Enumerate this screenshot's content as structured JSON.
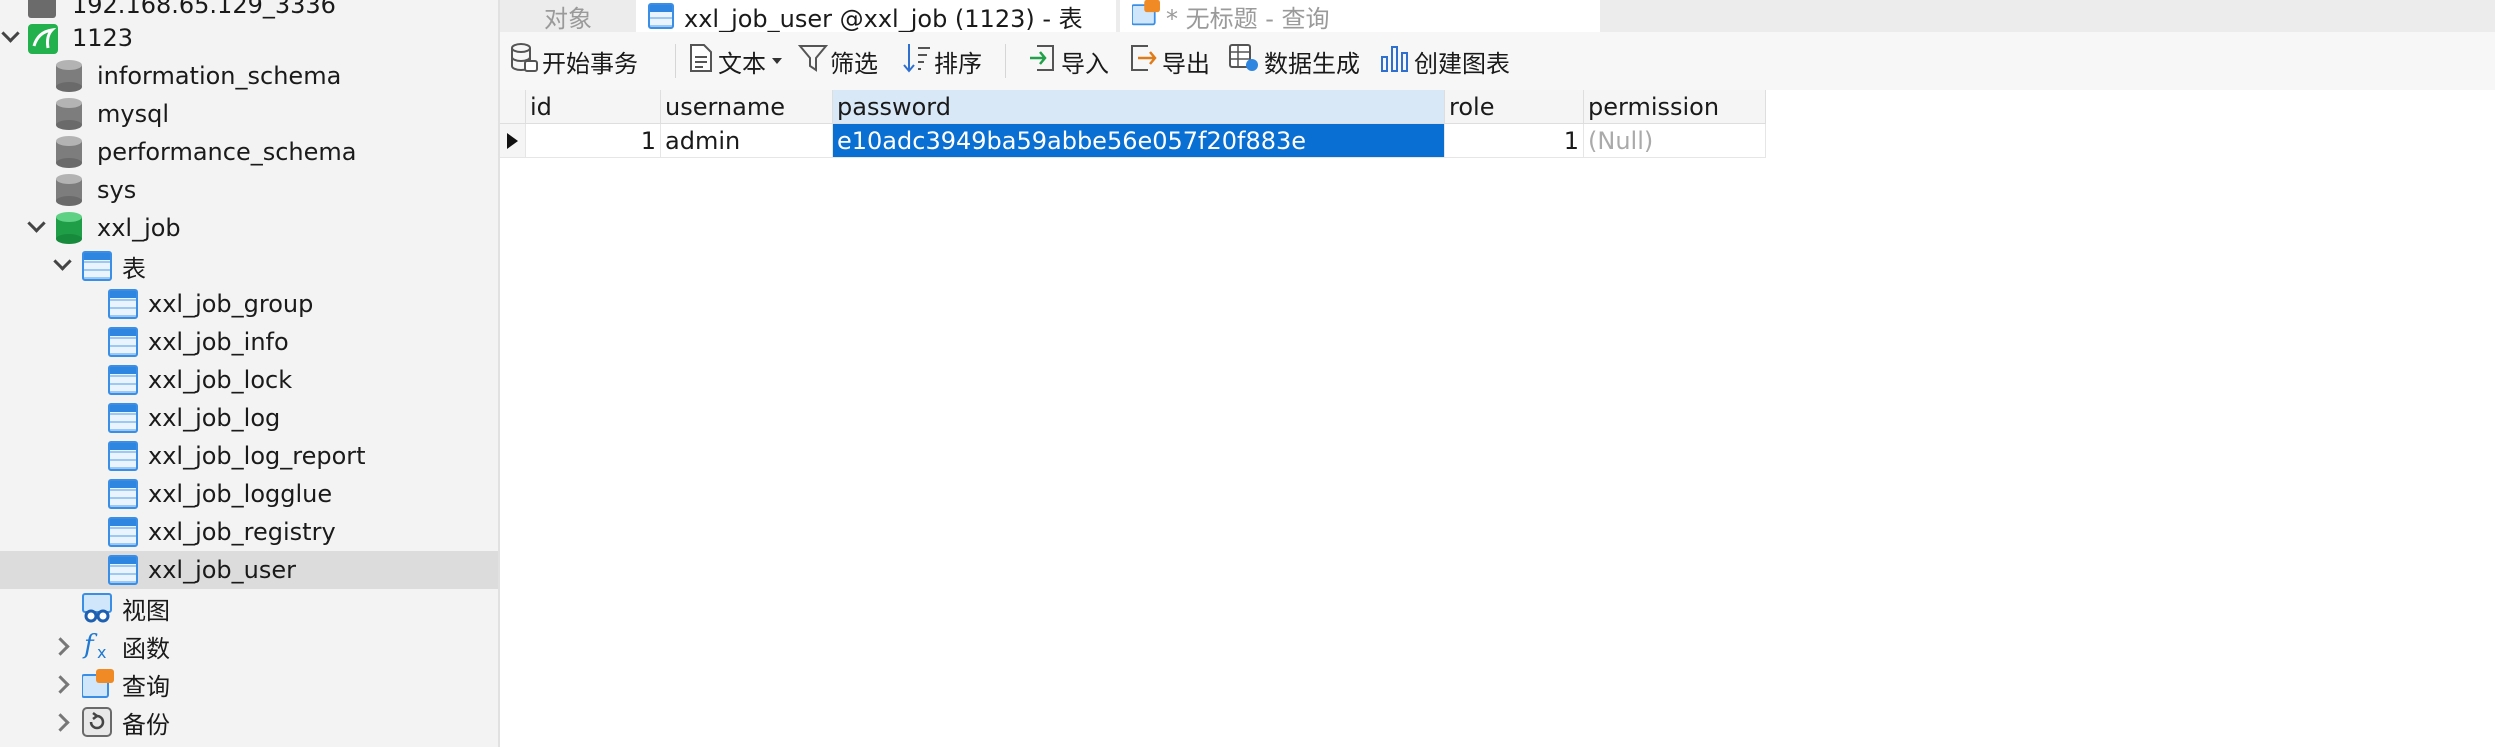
{
  "sidebar": {
    "connection_label": "192.168.65.129_3336",
    "db_root_label": "1123",
    "schemas": [
      "information_schema",
      "mysql",
      "performance_schema",
      "sys"
    ],
    "active_db": "xxl_job",
    "tables_folder": "表",
    "tables": [
      "xxl_job_group",
      "xxl_job_info",
      "xxl_job_lock",
      "xxl_job_log",
      "xxl_job_log_report",
      "xxl_job_logglue",
      "xxl_job_registry",
      "xxl_job_user"
    ],
    "selected_table": "xxl_job_user",
    "views_folder": "视图",
    "functions_folder": "函数",
    "queries_folder": "查询",
    "backups_folder": "备份"
  },
  "tabs": {
    "objects": "对象",
    "table_tab": "xxl_job_user @xxl_job (1123) - 表",
    "query_tab": "* 无标题 - 查询"
  },
  "toolbar": {
    "begin_transaction": "开始事务",
    "text": "文本",
    "filter": "筛选",
    "sort": "排序",
    "import": "导入",
    "export": "导出",
    "data_generation": "数据生成",
    "create_chart": "创建图表"
  },
  "grid": {
    "columns": [
      "id",
      "username",
      "password",
      "role",
      "permission"
    ],
    "rows": [
      {
        "id": "1",
        "username": "admin",
        "password": "e10adc3949ba59abbe56e057f20f883e",
        "role": "1",
        "permission": "(Null)"
      }
    ]
  },
  "colors": {
    "selection": "#0a6fd3",
    "header_selected": "#d9e8f7"
  }
}
